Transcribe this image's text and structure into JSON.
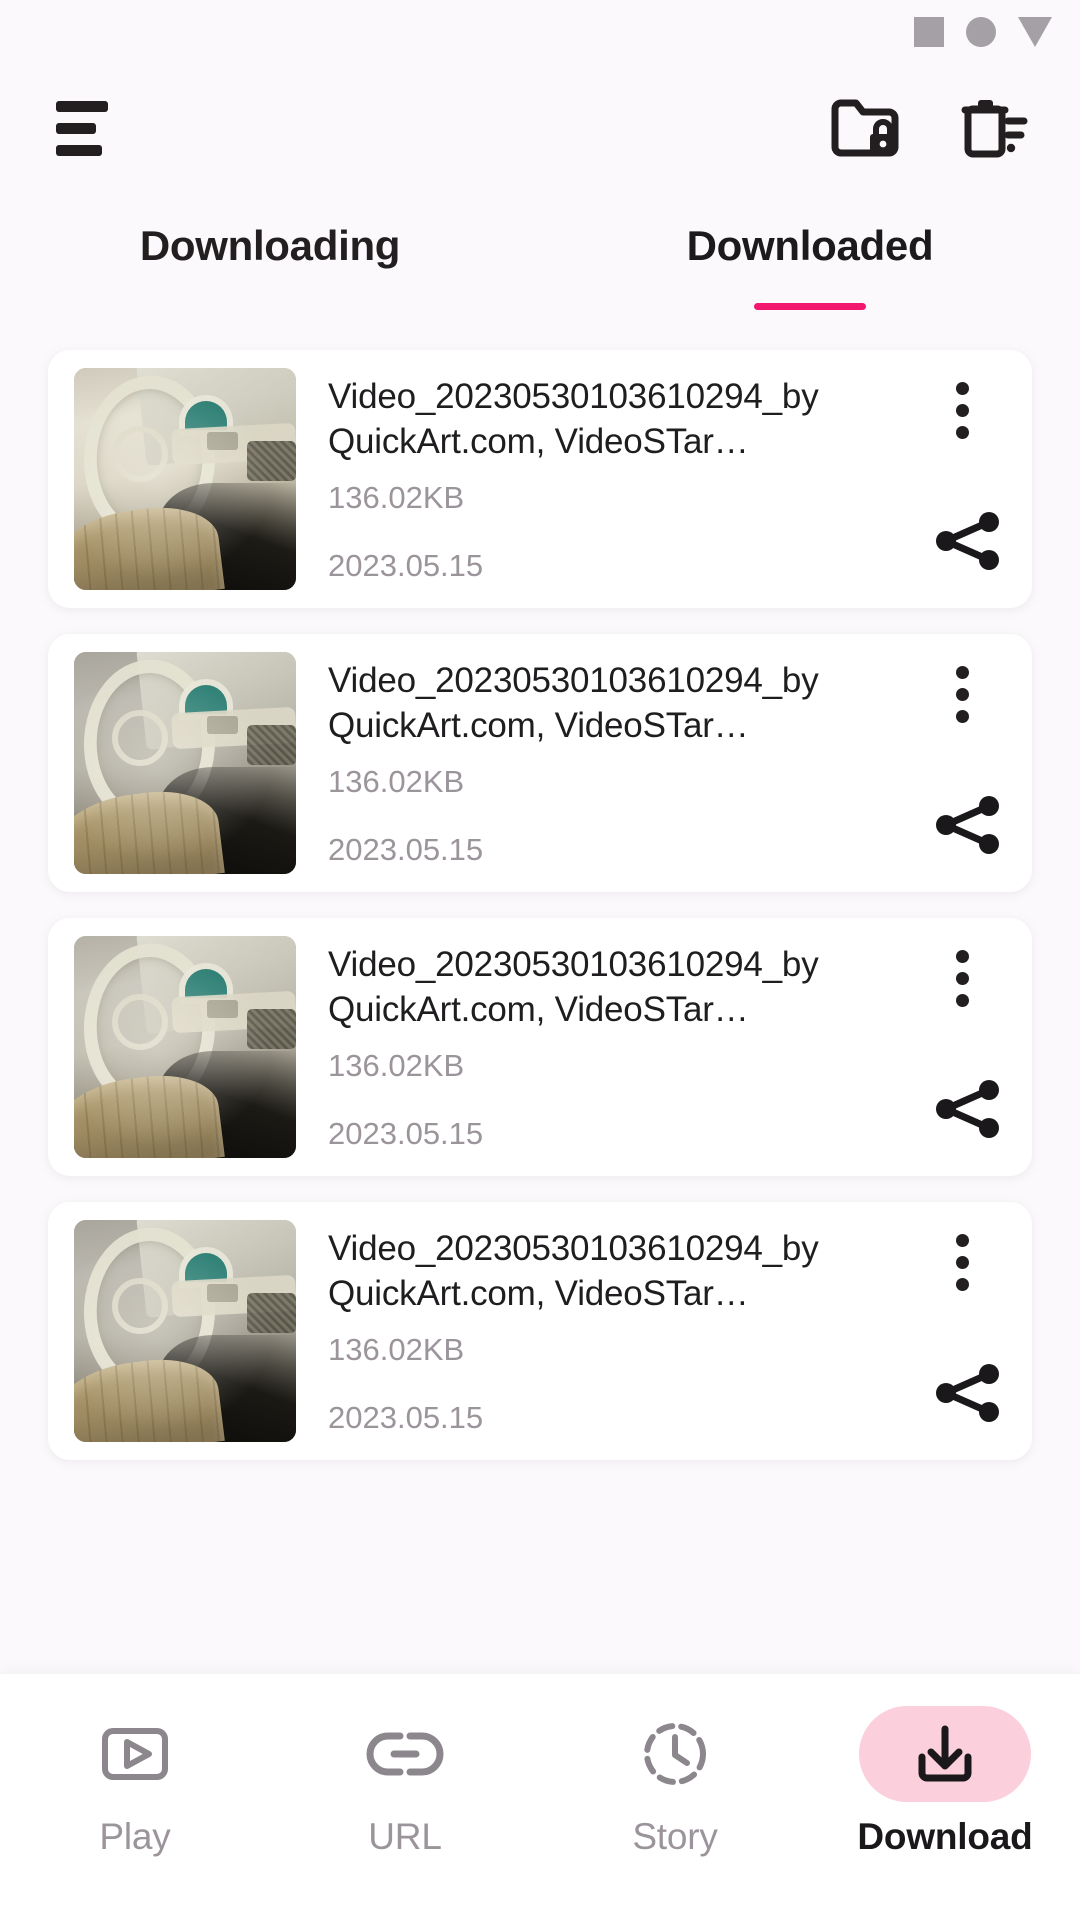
{
  "status_bar": {
    "icons": [
      {
        "name": "square-indicator-icon",
        "shape": "square"
      },
      {
        "name": "circle-indicator-icon",
        "shape": "circle"
      },
      {
        "name": "triangle-indicator-icon",
        "shape": "triangle-down"
      }
    ],
    "color": "#A5A0A5"
  },
  "header": {
    "menu_icon": "hamburger-menu-icon",
    "actions": [
      {
        "name": "private-folder-icon",
        "label": "Private folder"
      },
      {
        "name": "delete-list-icon",
        "label": "Delete"
      }
    ]
  },
  "tabs": {
    "active_index": 1,
    "indicator_color": "#F2176F",
    "items": [
      {
        "label": "Downloading",
        "active": false
      },
      {
        "label": "Downloaded",
        "active": true
      }
    ]
  },
  "list": {
    "items": [
      {
        "title": "Video_20230530103610294_by QuickArt.com, VideoSTar…",
        "size": "136.02KB",
        "date": "2023.05.15",
        "menu_icon": "more-options-icon",
        "share_icon": "share-icon",
        "thumbnail": "vintage-car-interior-thumbnail"
      },
      {
        "title": "Video_20230530103610294_by QuickArt.com, VideoSTar…",
        "size": "136.02KB",
        "date": "2023.05.15",
        "menu_icon": "more-options-icon",
        "share_icon": "share-icon",
        "thumbnail": "vintage-car-interior-thumbnail"
      },
      {
        "title": "Video_20230530103610294_by QuickArt.com, VideoSTar…",
        "size": "136.02KB",
        "date": "2023.05.15",
        "menu_icon": "more-options-icon",
        "share_icon": "share-icon",
        "thumbnail": "vintage-car-interior-thumbnail"
      },
      {
        "title": "Video_20230530103610294_by QuickArt.com, VideoSTar…",
        "size": "136.02KB",
        "date": "2023.05.15",
        "menu_icon": "more-options-icon",
        "share_icon": "share-icon",
        "thumbnail": "vintage-car-interior-thumbnail"
      }
    ]
  },
  "bottom_nav": {
    "active_index": 3,
    "active_pill_color": "#FBD0DC",
    "inactive_color": "#9B959B",
    "items": [
      {
        "label": "Play",
        "icon": "play-video-icon",
        "active": false
      },
      {
        "label": "URL",
        "icon": "link-icon",
        "active": false
      },
      {
        "label": "Story",
        "icon": "story-clock-icon",
        "active": false
      },
      {
        "label": "Download",
        "icon": "download-icon",
        "active": true
      }
    ]
  }
}
